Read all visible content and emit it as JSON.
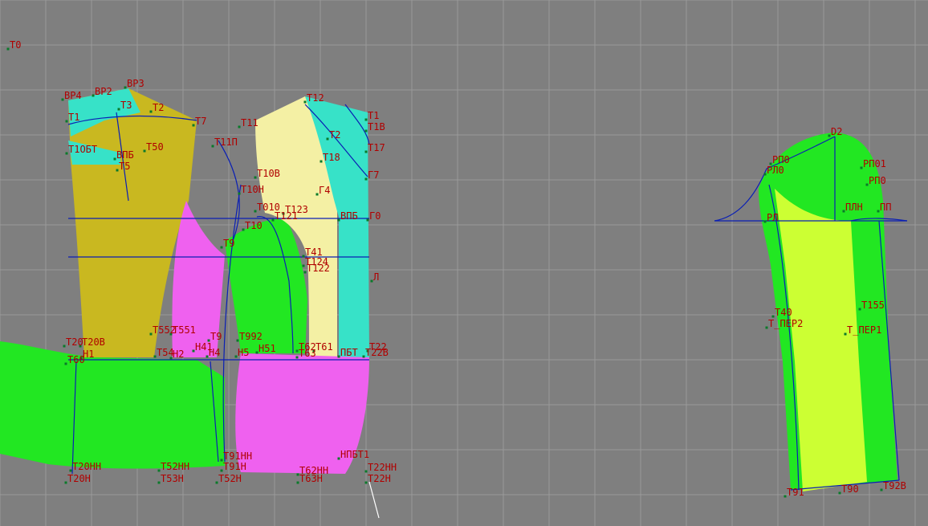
{
  "colors": {
    "background": "#7f7f7f",
    "grid": "#9a9a9a",
    "green": "#22e722",
    "yellow": "#c9b820",
    "magenta": "#ef61ef",
    "cream": "#f4f0a4",
    "cyan": "#37e2c8",
    "lime": "#ccff33",
    "blue_line": "#0a1fb4",
    "label": "#b00000",
    "point": "#0a7a2a"
  },
  "labels": [
    "T0",
    "BP4",
    "BP3",
    "BP2",
    "T3",
    "T2",
    "T7",
    "T1",
    "T1ОБТ",
    "ВПБ",
    "T50",
    "T5",
    "T11П",
    "T11",
    "T10B",
    "T10H",
    "T010",
    "T121",
    "T123",
    "T10",
    "T9",
    "T41",
    "T124",
    "T122",
    "T2",
    "T1",
    "T22",
    "T12",
    "T1B",
    "T17",
    "T18",
    "Г4",
    "Г7",
    "Г0",
    "ВПБ",
    "Л",
    "T20",
    "T20B",
    "H1",
    "T60",
    "T552",
    "T551",
    "T54",
    "H2",
    "H41",
    "H4",
    "T9",
    "T992",
    "H5",
    "H51",
    "T62",
    "T61",
    "T63",
    "ПБТ",
    "T22B",
    "T20HH",
    "T20H",
    "T52HH",
    "T53H",
    "T52H",
    "T91HH",
    "T91H",
    "T62HH",
    "T63H",
    "НПБТ1",
    "T22HH",
    "T22H",
    "D2",
    "PП0",
    "РП01",
    "PП0",
    "ПП",
    "ПЛН",
    "PЛ",
    "PЛ0",
    "T40",
    "T_ПЕР2",
    "T_ПЕР1",
    "T155",
    "T91",
    "T92B",
    "T90"
  ]
}
